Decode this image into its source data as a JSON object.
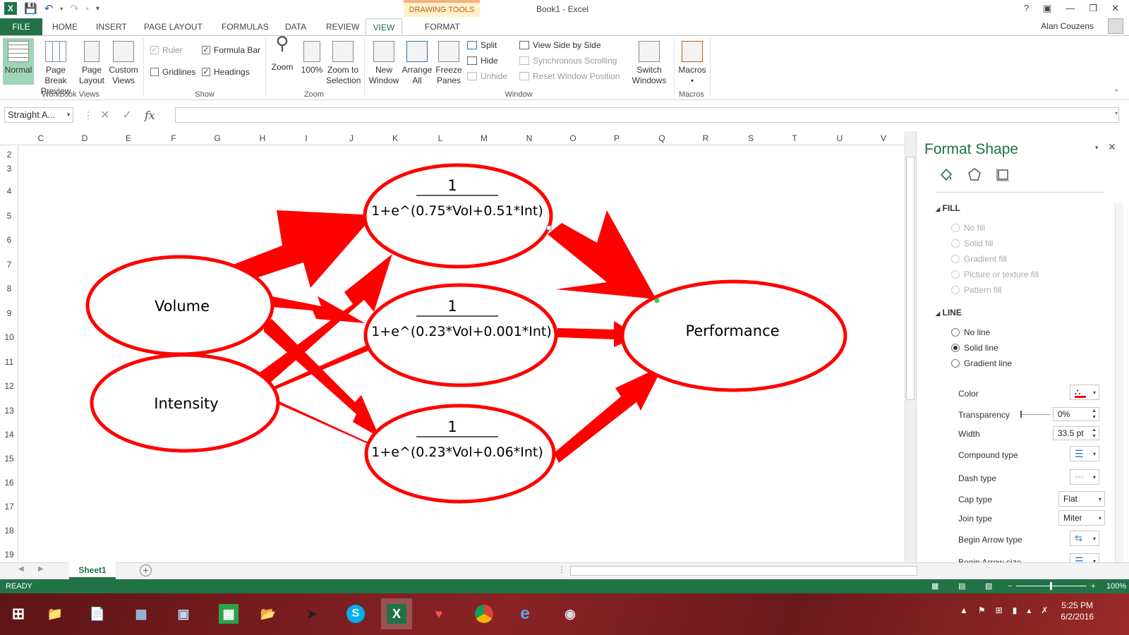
{
  "window": {
    "title": "Book1 - Excel",
    "contextual_tab_group": "DRAWING TOOLS",
    "user": "Alan Couzens",
    "help": "?"
  },
  "tabs": [
    "FILE",
    "HOME",
    "INSERT",
    "PAGE LAYOUT",
    "FORMULAS",
    "DATA",
    "REVIEW",
    "VIEW",
    "FORMAT"
  ],
  "ribbon": {
    "workbook_views": {
      "label": "Workbook Views",
      "normal": "Normal",
      "page_break_1": "Page Break",
      "page_break_2": "Preview",
      "page_layout_1": "Page",
      "page_layout_2": "Layout",
      "custom_1": "Custom",
      "custom_2": "Views"
    },
    "show": {
      "label": "Show",
      "ruler": "Ruler",
      "formula_bar": "Formula Bar",
      "gridlines": "Gridlines",
      "headings": "Headings"
    },
    "zoom": {
      "label": "Zoom",
      "zoom": "Zoom",
      "hundred": "100%",
      "sel_1": "Zoom to",
      "sel_2": "Selection"
    },
    "window": {
      "label": "Window",
      "new_1": "New",
      "new_2": "Window",
      "arrange_1": "Arrange",
      "arrange_2": "All",
      "freeze_1": "Freeze",
      "freeze_2": "Panes",
      "split": "Split",
      "hide": "Hide",
      "unhide": "Unhide",
      "side_by_side": "View Side by Side",
      "sync_scroll": "Synchronous Scrolling",
      "reset_pos": "Reset Window Position",
      "switch_1": "Switch",
      "switch_2": "Windows"
    },
    "macros": {
      "label": "Macros",
      "macros": "Macros"
    }
  },
  "formula_bar": {
    "name_box": "Straight A...",
    "fx": "fx",
    "value": ""
  },
  "columns": [
    "C",
    "D",
    "E",
    "F",
    "G",
    "H",
    "I",
    "J",
    "K",
    "L",
    "M",
    "N",
    "O",
    "P",
    "Q",
    "R",
    "S",
    "T",
    "U",
    "V"
  ],
  "rows": [
    "2",
    "3",
    "4",
    "5",
    "6",
    "7",
    "8",
    "9",
    "10",
    "11",
    "12",
    "13",
    "14",
    "15",
    "16",
    "17",
    "18",
    "19"
  ],
  "diagram": {
    "nodes": {
      "volume": "Volume",
      "intensity": "Intensity",
      "performance": "Performance"
    },
    "hidden_nodes": [
      {
        "numerator": "1",
        "denominator": "1+e^(0.75*Vol+0.51*Int)"
      },
      {
        "numerator": "1",
        "denominator": "1+e^(0.23*Vol+0.001*Int)"
      },
      {
        "numerator": "1",
        "denominator": "1+e^(0.23*Vol+0.06*Int)"
      }
    ],
    "accent_color": "#ff0000"
  },
  "format_pane": {
    "title": "Format Shape",
    "fill": {
      "heading": "FILL",
      "options": [
        "No fill",
        "Solid fill",
        "Gradient fill",
        "Picture or texture fill",
        "Pattern fill"
      ]
    },
    "line": {
      "heading": "LINE",
      "options": [
        "No line",
        "Solid line",
        "Gradient line"
      ],
      "selected": "Solid line"
    },
    "props": {
      "color": "Color",
      "transparency": "Transparency",
      "transparency_value": "0%",
      "width": "Width",
      "width_value": "33.5 pt",
      "compound": "Compound type",
      "dash": "Dash type",
      "cap": "Cap type",
      "cap_value": "Flat",
      "join": "Join type",
      "join_value": "Miter",
      "begin_arrow_type": "Begin Arrow type",
      "begin_arrow_size": "Begin Arrow size"
    }
  },
  "sheet": {
    "tab": "Sheet1"
  },
  "status": {
    "ready": "READY",
    "zoom": "100%"
  },
  "taskbar": {
    "time": "5:25 PM",
    "date": "6/2/2016"
  }
}
